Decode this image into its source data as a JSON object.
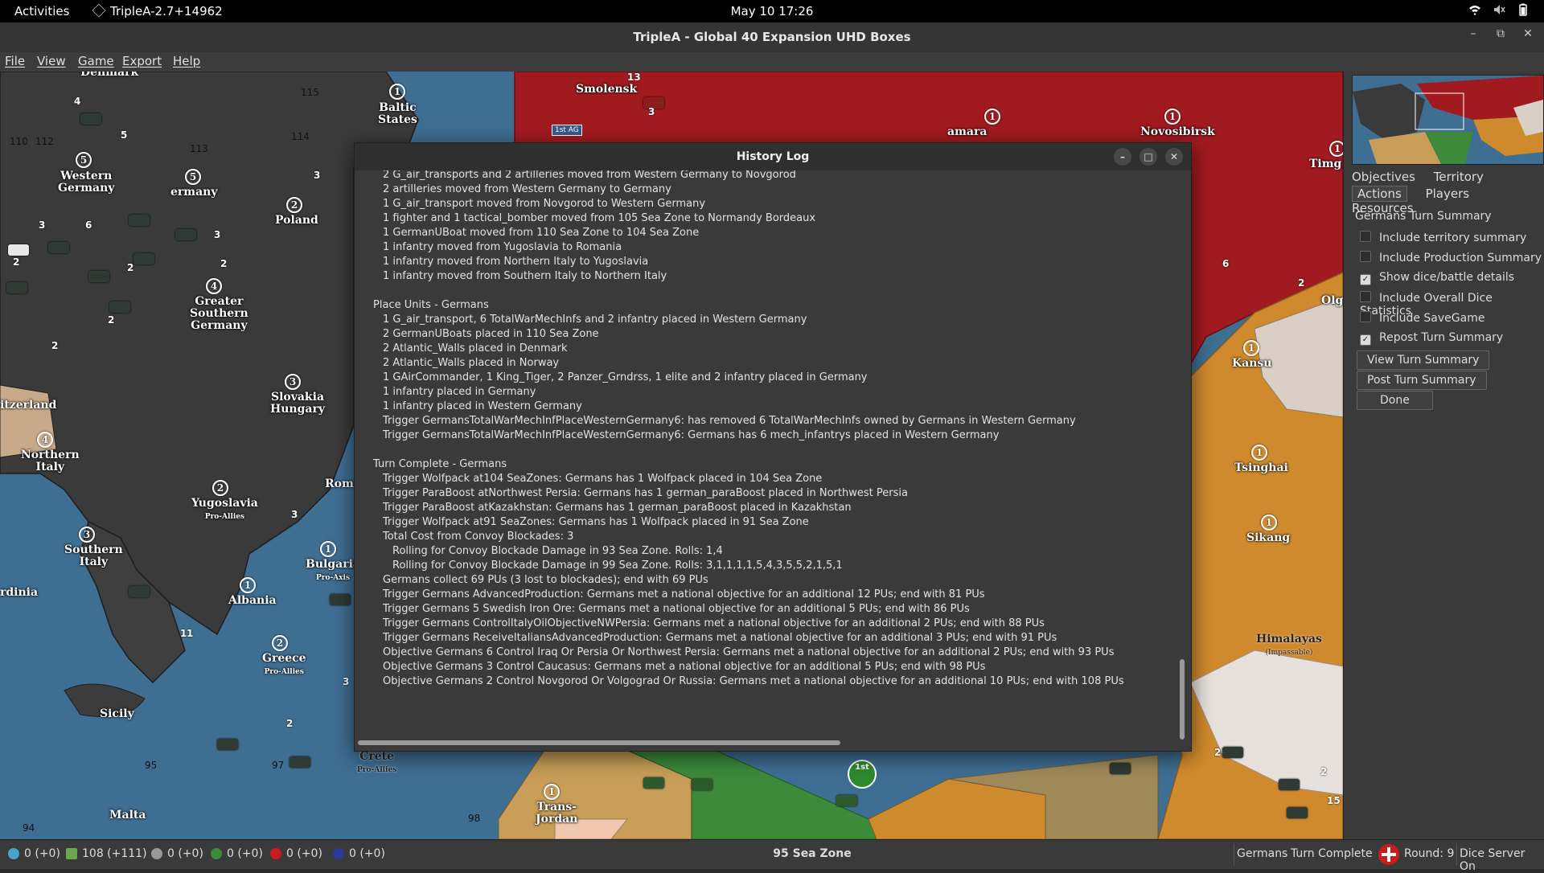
{
  "topbar": {
    "activities": "Activities",
    "app": "TripleA-2.7+14962",
    "clock": "May 10  17:26"
  },
  "window": {
    "title": "TripleA - Global 40 Expansion UHD Boxes"
  },
  "menu": [
    "File",
    "View",
    "Game",
    "Export",
    "Help"
  ],
  "map": {
    "territories": [
      "Denmark",
      "Baltic States",
      "Smolensk",
      "amara",
      "Novosibirsk",
      "Timg",
      "Western Germany",
      "ermany",
      "Poland",
      "Greater Southern Germany",
      "Slovakia Hungary",
      "itzerland",
      "Northern Italy",
      "Yugoslavia",
      "Rom",
      "Southern Italy",
      "Bulgaria",
      "Albania",
      "rdinia",
      "Greece",
      "Sicily",
      "Crete",
      "Malta",
      "Trans-Jordan",
      "Kansu",
      "Olg",
      "Tsinghai",
      "Sikang",
      "Himalayas"
    ],
    "sub_labels": [
      "Pro-Allies",
      "Pro-Axis",
      "Pro-Allies",
      "Pro-Allies",
      "(Impassable)"
    ],
    "production": [
      "1",
      "5",
      "5",
      "2",
      "4",
      "3",
      "4",
      "2",
      "3",
      "1",
      "1",
      "2",
      "1",
      "1",
      "1",
      "1",
      "1",
      "1",
      "1"
    ],
    "sea_zones": [
      "115",
      "114",
      "110",
      "112",
      "113",
      "95",
      "97",
      "94",
      "98",
      "1st AG"
    ],
    "unit_counts": [
      "13",
      "4",
      "5",
      "3",
      "6",
      "2",
      "3",
      "2",
      "2",
      "2",
      "3",
      "3",
      "3",
      "2",
      "2",
      "6",
      "2",
      "2",
      "2",
      "15",
      "1",
      "1",
      "3"
    ],
    "badge": "1st"
  },
  "history": {
    "title": "History Log",
    "lines": [
      {
        "i": 1,
        "t": "2 G_air_transports and 2 artilleries moved from Western Germany to Novgorod"
      },
      {
        "i": 1,
        "t": "2 artilleries moved from Western Germany to Germany"
      },
      {
        "i": 1,
        "t": "1 G_air_transport moved from Novgorod to Western Germany"
      },
      {
        "i": 1,
        "t": "1 fighter and 1 tactical_bomber moved from 105 Sea Zone to Normandy Bordeaux"
      },
      {
        "i": 1,
        "t": "1 GermanUBoat moved from 110 Sea Zone to 104 Sea Zone"
      },
      {
        "i": 1,
        "t": "1 infantry moved from Yugoslavia to Romania"
      },
      {
        "i": 1,
        "t": "1 infantry moved from Northern Italy to Yugoslavia"
      },
      {
        "i": 1,
        "t": "1 infantry moved from Southern Italy to Northern Italy"
      },
      {
        "i": 0,
        "t": ""
      },
      {
        "i": 0,
        "t": "Place Units - Germans"
      },
      {
        "i": 1,
        "t": "1 G_air_transport, 6 TotalWarMechInfs and 2 infantry placed in Western Germany"
      },
      {
        "i": 1,
        "t": "2 GermanUBoats placed in 110 Sea Zone"
      },
      {
        "i": 1,
        "t": "2 Atlantic_Walls placed in Denmark"
      },
      {
        "i": 1,
        "t": "2 Atlantic_Walls placed in Norway"
      },
      {
        "i": 1,
        "t": "1 GAirCommander, 1 King_Tiger, 2 Panzer_Grndrss, 1 elite and 2 infantry placed in Germany"
      },
      {
        "i": 1,
        "t": "1 infantry placed in Germany"
      },
      {
        "i": 1,
        "t": "1 infantry placed in Western Germany"
      },
      {
        "i": 1,
        "t": "Trigger GermansTotalWarMechInfPlaceWesternGermany6: has removed 6 TotalWarMechInfs owned by Germans in Western Germany"
      },
      {
        "i": 1,
        "t": "Trigger GermansTotalWarMechInfPlaceWesternGermany6: Germans has 6 mech_infantrys placed in Western Germany"
      },
      {
        "i": 0,
        "t": ""
      },
      {
        "i": 0,
        "t": "Turn Complete - Germans"
      },
      {
        "i": 1,
        "t": "Trigger Wolfpack at104 SeaZones: Germans has 1 Wolfpack placed in 104 Sea Zone"
      },
      {
        "i": 1,
        "t": "Trigger ParaBoost atNorthwest Persia: Germans has 1 german_paraBoost placed in Northwest Persia"
      },
      {
        "i": 1,
        "t": "Trigger ParaBoost atKazakhstan: Germans has 1 german_paraBoost placed in Kazakhstan"
      },
      {
        "i": 1,
        "t": "Trigger Wolfpack at91 SeaZones: Germans has 1 Wolfpack placed in 91 Sea Zone"
      },
      {
        "i": 1,
        "t": "Total Cost from Convoy Blockades: 3"
      },
      {
        "i": 2,
        "t": "Rolling for Convoy Blockade Damage in 93 Sea Zone. Rolls: 1,4"
      },
      {
        "i": 2,
        "t": "Rolling for Convoy Blockade Damage in 99 Sea Zone. Rolls: 3,1,1,1,1,5,4,3,5,5,2,1,5,1"
      },
      {
        "i": 1,
        "t": "Germans collect 69 PUs (3 lost to blockades); end with 69 PUs"
      },
      {
        "i": 1,
        "t": "Trigger Germans AdvancedProduction: Germans met a national objective for an additional 12 PUs; end with 81 PUs"
      },
      {
        "i": 1,
        "t": "Trigger Germans 5 Swedish Iron Ore: Germans met a national objective for an additional 5 PUs; end with 86 PUs"
      },
      {
        "i": 1,
        "t": "Trigger Germans ControlItalyOilObjectiveNWPersia: Germans met a national objective for an additional 2 PUs; end with 88 PUs"
      },
      {
        "i": 1,
        "t": "Trigger Germans ReceiveItaliansAdvancedProduction: Germans met a national objective for an additional 3 PUs; end with 91 PUs"
      },
      {
        "i": 1,
        "t": "Objective Germans 6 Control Iraq Or Persia Or Northwest Persia: Germans met a national objective for an additional 2 PUs; end with 93 PUs"
      },
      {
        "i": 1,
        "t": "Objective Germans 3 Control Caucasus: Germans met a national objective for an additional 5 PUs; end with 98 PUs"
      },
      {
        "i": 1,
        "t": "Objective Germans 2 Control Novgorod Or Volgograd Or Russia: Germans met a national objective for an additional 10 PUs; end with 108 PUs"
      }
    ]
  },
  "right": {
    "tabs_row1": [
      "Objectives",
      "Territory"
    ],
    "tabs_row2": [
      "Actions",
      "Players",
      "Resources"
    ],
    "summary_title": "Germans Turn Summary",
    "checks": [
      {
        "label": "Include territory summary",
        "checked": false
      },
      {
        "label": "Include Production Summary",
        "checked": false
      },
      {
        "label": "Show dice/battle details",
        "checked": true
      },
      {
        "label": "Include Overall Dice Statistics",
        "checked": false
      },
      {
        "label": "Include SaveGame",
        "checked": false
      },
      {
        "label": "Repost Turn Summary",
        "checked": true
      }
    ],
    "buttons": [
      "View Turn Summary",
      "Post Turn Summary",
      "Done"
    ]
  },
  "status": {
    "resources": [
      "0 (+0)",
      "108 (+111)",
      "0 (+0)",
      "0 (+0)",
      "0 (+0)",
      "0 (+0)"
    ],
    "resource_icons": [
      "fuel-icon",
      "pu-icon",
      "tech-icon",
      "lend-lease-icon",
      "tank-lend-lease-icon",
      "navy-lend-lease-icon"
    ],
    "zone": "95 Sea Zone",
    "player": "Germans",
    "phase": "Turn Complete",
    "round": "Round: 9",
    "dice": "Dice Server On"
  },
  "colors": {
    "germany": "#3a3a3a",
    "russia": "#a11a1f",
    "china": "#d08a2e",
    "uk": "#3c8a3a",
    "sea": "#3f6e93",
    "neutral": "#e6e1dc"
  }
}
